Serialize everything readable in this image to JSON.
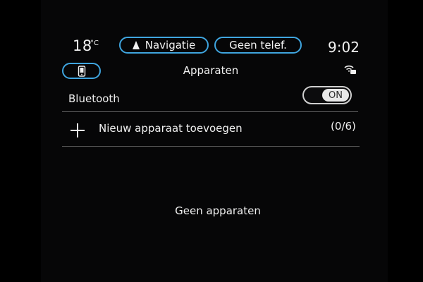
{
  "status_bar": {
    "temperature": "18",
    "temperature_unit": "°C",
    "navigation_label": "Navigatie",
    "phone_label": "Geen telef.",
    "time": "9:02"
  },
  "header": {
    "device_icon": "phone-device-icon",
    "title": "Apparaten",
    "connectivity_icon": "wireless-projection-icon"
  },
  "bluetooth": {
    "label": "Bluetooth",
    "toggle_state": "ON"
  },
  "add_device": {
    "icon": "plus-icon",
    "label": "Nieuw apparaat toevoegen",
    "count": "(0/6)"
  },
  "empty_message": "Geen apparaten",
  "colors": {
    "accent": "#3fa5df",
    "background": "#060607",
    "text": "#f0f0f0"
  }
}
